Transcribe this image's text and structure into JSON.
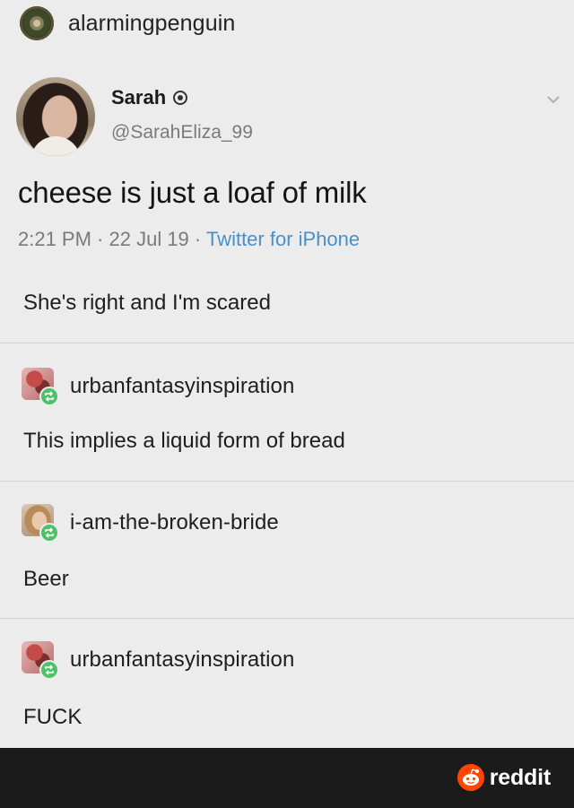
{
  "post": {
    "username": "alarmingpenguin"
  },
  "tweet": {
    "name": "Sarah",
    "handle": "@SarahEliza_99",
    "text": "cheese is just a loaf of milk",
    "time": "2:21 PM",
    "date": "22 Jul 19",
    "source": "Twitter for iPhone",
    "sep": " · "
  },
  "comments": [
    {
      "text": "She's right and I'm scared"
    },
    {
      "user": "urbanfantasyinspiration",
      "text": "This implies a liquid form of bread"
    },
    {
      "user": "i-am-the-broken-bride",
      "text": "Beer"
    },
    {
      "user": "urbanfantasyinspiration",
      "text": "FUCK"
    }
  ],
  "watermark": {
    "label": "reddit",
    "color": "#ff4500"
  },
  "colors": {
    "background": "#ececec",
    "link": "#4a90c8",
    "reblog_badge": "#4fc16a",
    "bottom_bar": "#1b1b1b"
  }
}
